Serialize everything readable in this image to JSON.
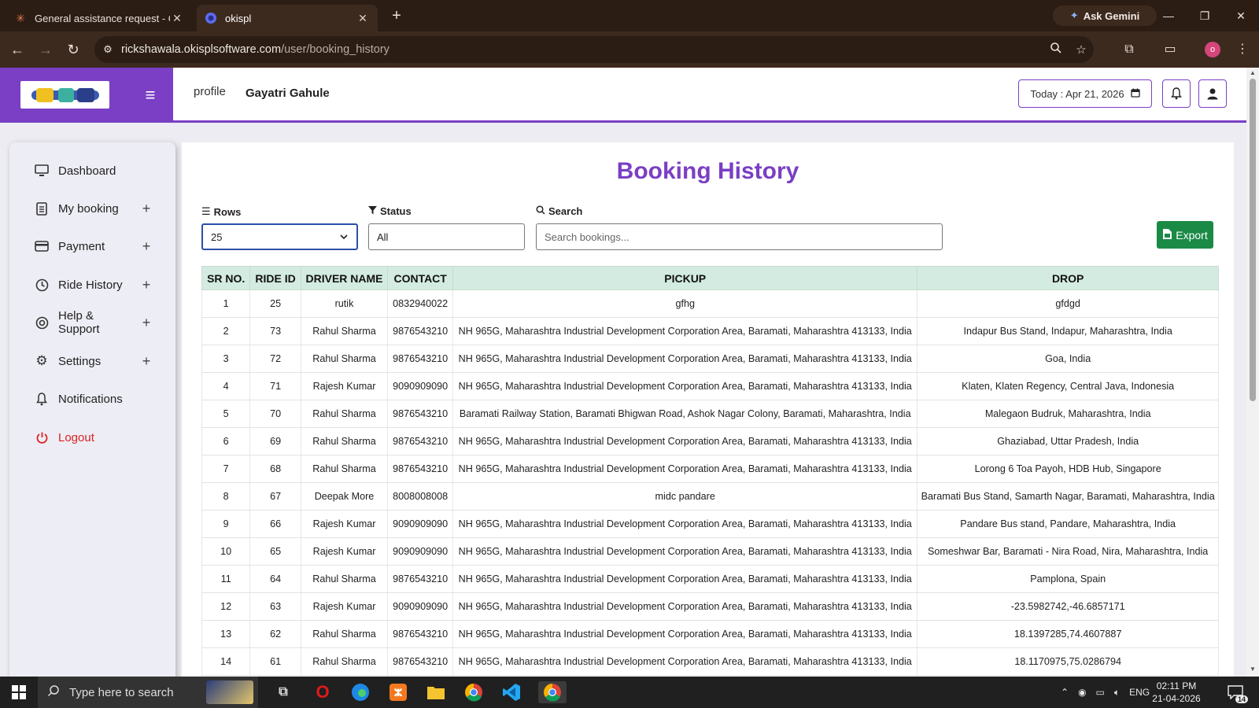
{
  "browser": {
    "tabs": [
      {
        "title": "General assistance request - Cla",
        "active": false
      },
      {
        "title": "okispl",
        "active": true
      }
    ],
    "ask_gemini": "Ask Gemini",
    "url_host": "rickshawala.okisplsoftware.com",
    "url_path": "/user/booking_history",
    "profile_initial": "o"
  },
  "header": {
    "profile_alt": "profile",
    "user_name": "Gayatri Gahule",
    "today": "Today : Apr 21, 2026"
  },
  "sidebar": {
    "items": [
      {
        "label": "Dashboard",
        "icon": "monitor-icon",
        "expandable": false
      },
      {
        "label": "My booking",
        "icon": "clipboard-icon",
        "expandable": true
      },
      {
        "label": "Payment",
        "icon": "card-icon",
        "expandable": true
      },
      {
        "label": "Ride History",
        "icon": "clock-icon",
        "expandable": true
      },
      {
        "label": "Help & Support",
        "icon": "support-icon",
        "expandable": true
      },
      {
        "label": "Settings",
        "icon": "gear-icon",
        "expandable": true
      },
      {
        "label": "Notifications",
        "icon": "bell-icon",
        "expandable": false
      },
      {
        "label": "Logout",
        "icon": "power-icon",
        "expandable": false
      }
    ]
  },
  "main": {
    "title": "Booking History",
    "rows_label": "Rows",
    "rows_value": "25",
    "status_label": "Status",
    "status_value": "All",
    "search_label": "Search",
    "search_placeholder": "Search bookings...",
    "export_label": "Export"
  },
  "table": {
    "columns": [
      "SR NO.",
      "RIDE ID",
      "DRIVER NAME",
      "CONTACT",
      "PICKUP",
      "DROP"
    ],
    "rows": [
      [
        "1",
        "25",
        "rutik",
        "0832940022",
        "gfhg",
        "gfdgd"
      ],
      [
        "2",
        "73",
        "Rahul Sharma",
        "9876543210",
        "NH 965G, Maharashtra Industrial Development Corporation Area, Baramati, Maharashtra 413133, India",
        "Indapur Bus Stand, Indapur, Maharashtra, India"
      ],
      [
        "3",
        "72",
        "Rahul Sharma",
        "9876543210",
        "NH 965G, Maharashtra Industrial Development Corporation Area, Baramati, Maharashtra 413133, India",
        "Goa, India"
      ],
      [
        "4",
        "71",
        "Rajesh Kumar",
        "9090909090",
        "NH 965G, Maharashtra Industrial Development Corporation Area, Baramati, Maharashtra 413133, India",
        "Klaten, Klaten Regency, Central Java, Indonesia"
      ],
      [
        "5",
        "70",
        "Rahul Sharma",
        "9876543210",
        "Baramati Railway Station, Baramati Bhigwan Road, Ashok Nagar Colony, Baramati, Maharashtra, India",
        "Malegaon Budruk, Maharashtra, India"
      ],
      [
        "6",
        "69",
        "Rahul Sharma",
        "9876543210",
        "NH 965G, Maharashtra Industrial Development Corporation Area, Baramati, Maharashtra 413133, India",
        "Ghaziabad, Uttar Pradesh, India"
      ],
      [
        "7",
        "68",
        "Rahul Sharma",
        "9876543210",
        "NH 965G, Maharashtra Industrial Development Corporation Area, Baramati, Maharashtra 413133, India",
        "Lorong 6 Toa Payoh, HDB Hub, Singapore"
      ],
      [
        "8",
        "67",
        "Deepak More",
        "8008008008",
        "midc pandare",
        "Baramati Bus Stand, Samarth Nagar, Baramati, Maharashtra, India"
      ],
      [
        "9",
        "66",
        "Rajesh Kumar",
        "9090909090",
        "NH 965G, Maharashtra Industrial Development Corporation Area, Baramati, Maharashtra 413133, India",
        "Pandare Bus stand, Pandare, Maharashtra, India"
      ],
      [
        "10",
        "65",
        "Rajesh Kumar",
        "9090909090",
        "NH 965G, Maharashtra Industrial Development Corporation Area, Baramati, Maharashtra 413133, India",
        "Someshwar Bar, Baramati - Nira Road, Nira, Maharashtra, India"
      ],
      [
        "11",
        "64",
        "Rahul Sharma",
        "9876543210",
        "NH 965G, Maharashtra Industrial Development Corporation Area, Baramati, Maharashtra 413133, India",
        "Pamplona, Spain"
      ],
      [
        "12",
        "63",
        "Rajesh Kumar",
        "9090909090",
        "NH 965G, Maharashtra Industrial Development Corporation Area, Baramati, Maharashtra 413133, India",
        "-23.5982742,-46.6857171"
      ],
      [
        "13",
        "62",
        "Rahul Sharma",
        "9876543210",
        "NH 965G, Maharashtra Industrial Development Corporation Area, Baramati, Maharashtra 413133, India",
        "18.1397285,74.4607887"
      ],
      [
        "14",
        "61",
        "Rahul Sharma",
        "9876543210",
        "NH 965G, Maharashtra Industrial Development Corporation Area, Baramati, Maharashtra 413133, India",
        "18.1170975,75.0286794"
      ]
    ]
  },
  "taskbar": {
    "search_placeholder": "Type here to search",
    "language": "ENG",
    "time": "02:11 PM",
    "date": "21-04-2026",
    "notification_count": "14"
  },
  "colors": {
    "brand": "#7a3fc4",
    "table_header": "#d3ebe0",
    "export": "#1a8a46",
    "logout": "#dd2222"
  }
}
